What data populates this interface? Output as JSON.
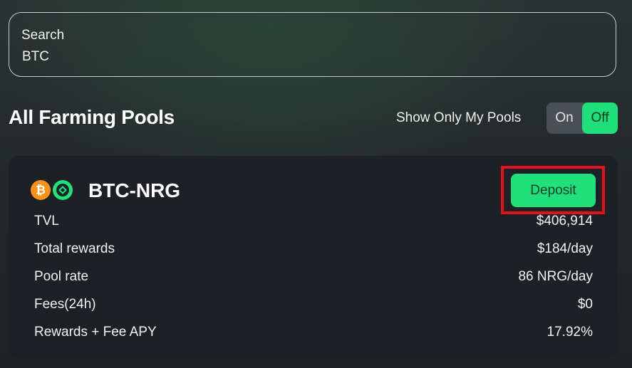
{
  "search": {
    "label": "Search",
    "value": "BTC"
  },
  "page_title": "All Farming Pools",
  "filter": {
    "label": "Show Only My Pools",
    "on_label": "On",
    "off_label": "Off",
    "selected": "Off"
  },
  "pool": {
    "name": "BTC-NRG",
    "icons": [
      "bitcoin-icon",
      "energi-icon"
    ],
    "deposit_label": "Deposit",
    "stats": [
      {
        "label": "TVL",
        "value": "$406,914"
      },
      {
        "label": "Total rewards",
        "value": "$184/day"
      },
      {
        "label": "Pool rate",
        "value": "86 NRG/day"
      },
      {
        "label": "Fees(24h)",
        "value": "$0"
      },
      {
        "label": "Rewards + Fee APY",
        "value": "17.92%"
      }
    ]
  },
  "colors": {
    "accent": "#1fe07a",
    "card": "#1d2024",
    "highlight": "#e0121b",
    "bitcoin": "#f7931a"
  }
}
